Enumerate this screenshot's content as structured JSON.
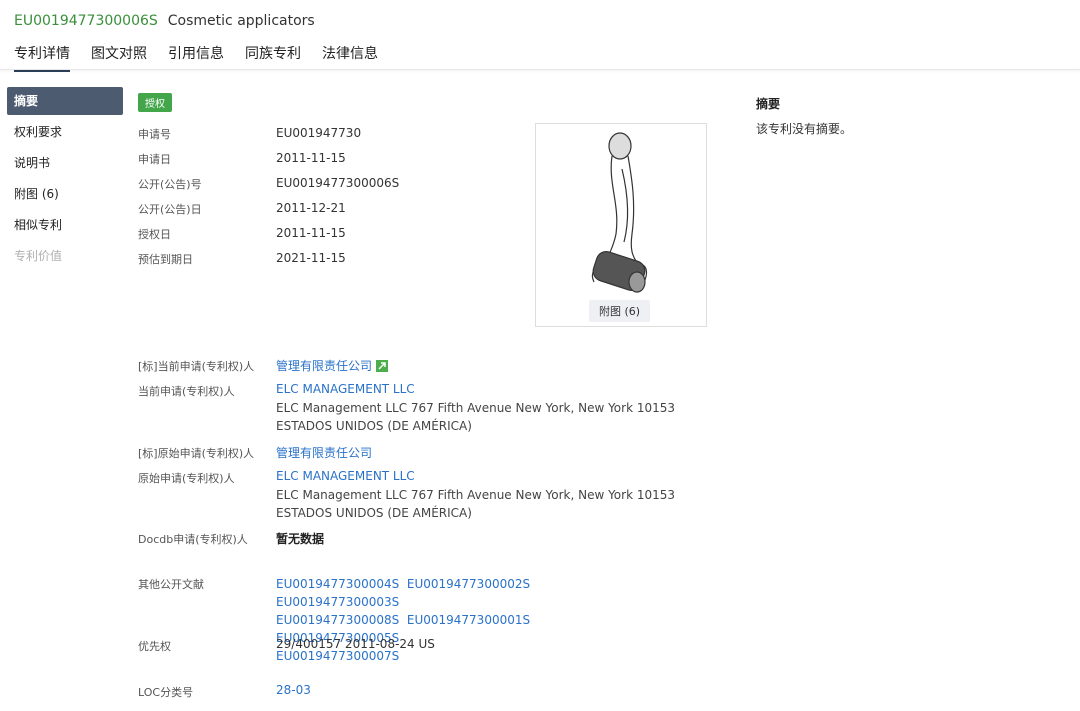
{
  "header": {
    "publication_no": "EU0019477300006S",
    "title": "Cosmetic applicators"
  },
  "tabs": [
    {
      "label": "专利详情"
    },
    {
      "label": "图文对照"
    },
    {
      "label": "引用信息"
    },
    {
      "label": "同族专利"
    },
    {
      "label": "法律信息"
    }
  ],
  "sidebar": {
    "items": [
      {
        "label": "摘要"
      },
      {
        "label": "权利要求"
      },
      {
        "label": "说明书"
      },
      {
        "label": "附图 (6)"
      },
      {
        "label": "相似专利"
      },
      {
        "label": "专利价值"
      }
    ]
  },
  "status_badge": "授权",
  "details": {
    "app_no_label": "申请号",
    "app_no": "EU001947730",
    "app_date_label": "申请日",
    "app_date": "2011-11-15",
    "pub_no_label": "公开(公告)号",
    "pub_no": "EU0019477300006S",
    "pub_date_label": "公开(公告)日",
    "pub_date": "2011-12-21",
    "grant_date_label": "授权日",
    "grant_date": "2011-11-15",
    "expiry_label": "预估到期日",
    "expiry": "2021-11-15"
  },
  "figure": {
    "button_label": "附图 (6)"
  },
  "applicants": {
    "std_current_label": "[标]当前申请(专利权)人",
    "std_current": "管理有限责任公司",
    "current_label": "当前申请(专利权)人",
    "current_name": "ELC MANAGEMENT LLC",
    "current_addr": "ELC Management LLC 767 Fifth Avenue New York, New York 10153 ESTADOS UNIDOS (DE AMÉRICA)",
    "std_original_label": "[标]原始申请(专利权)人",
    "std_original": "管理有限责任公司",
    "original_label": "原始申请(专利权)人",
    "original_name": "ELC MANAGEMENT LLC",
    "original_addr": "ELC Management LLC 767 Fifth Avenue New York, New York 10153 ESTADOS UNIDOS (DE AMÉRICA)",
    "docdb_label": "Docdb申请(专利权)人",
    "docdb_value": "暂无数据"
  },
  "other_docs": {
    "label": "其他公开文献",
    "items": [
      "EU0019477300004S",
      "EU0019477300002S",
      "EU0019477300003S",
      "EU0019477300008S",
      "EU0019477300001S",
      "EU0019477300005S",
      "EU0019477300007S"
    ]
  },
  "priority": {
    "label": "优先权",
    "value": "29/400157 2011-08-24 US"
  },
  "loc": {
    "label": "LOC分类号",
    "value": "28-03"
  },
  "abstract": {
    "title": "摘要",
    "text": "该专利没有摘要。"
  },
  "colors": {
    "accent_green": "#43a64a",
    "link_blue": "#2a72c9",
    "sidebar_active": "#4d5b70"
  },
  "icons": {
    "external_link": "external-link-icon"
  }
}
